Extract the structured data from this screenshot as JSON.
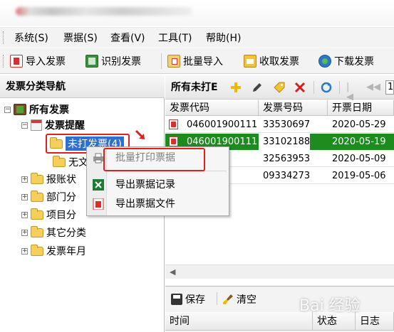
{
  "menubar": {
    "items": [
      "系统(S)",
      "票据(S)",
      "查看(V)",
      "工具(T)",
      "帮助(H)"
    ]
  },
  "toolbar": {
    "buttons": [
      "导入发票",
      "识别发票",
      "批量导入",
      "收取发票",
      "下载发票"
    ]
  },
  "left_panel": {
    "title": "发票分类导航",
    "tree": {
      "root": "所有发票",
      "remind": "发票提醒",
      "unprinted": "未打发票(4)",
      "no_file": "无文",
      "categories": [
        "报账状",
        "部门分",
        "项目分",
        "其它分类",
        "发票年月"
      ]
    }
  },
  "right_panel": {
    "title": "所有未打E",
    "page_input": "1",
    "columns": [
      "发票代码",
      "发票号码",
      "开票日期"
    ],
    "rows": [
      {
        "code": "046001900111",
        "number": "33530697",
        "date": "2020-05-29",
        "selected": false
      },
      {
        "code": "046001900111",
        "number": "33102188",
        "date": "2020-05-19",
        "selected": true
      },
      {
        "code": "111",
        "number": "32563953",
        "date": "2020-05-09",
        "selected": false
      },
      {
        "code": "1112",
        "number": "09334273",
        "date": "2019-05-06",
        "selected": false
      }
    ],
    "selected_color": "#1d8b1d"
  },
  "context_menu": {
    "items": [
      "批量打印票据",
      "导出票据记录",
      "导出票据文件"
    ]
  },
  "bottom_panel": {
    "save_label": "保存",
    "clear_label": "清空",
    "columns": [
      "时间",
      "状态",
      "日志"
    ]
  },
  "watermark": "Bai 经验"
}
